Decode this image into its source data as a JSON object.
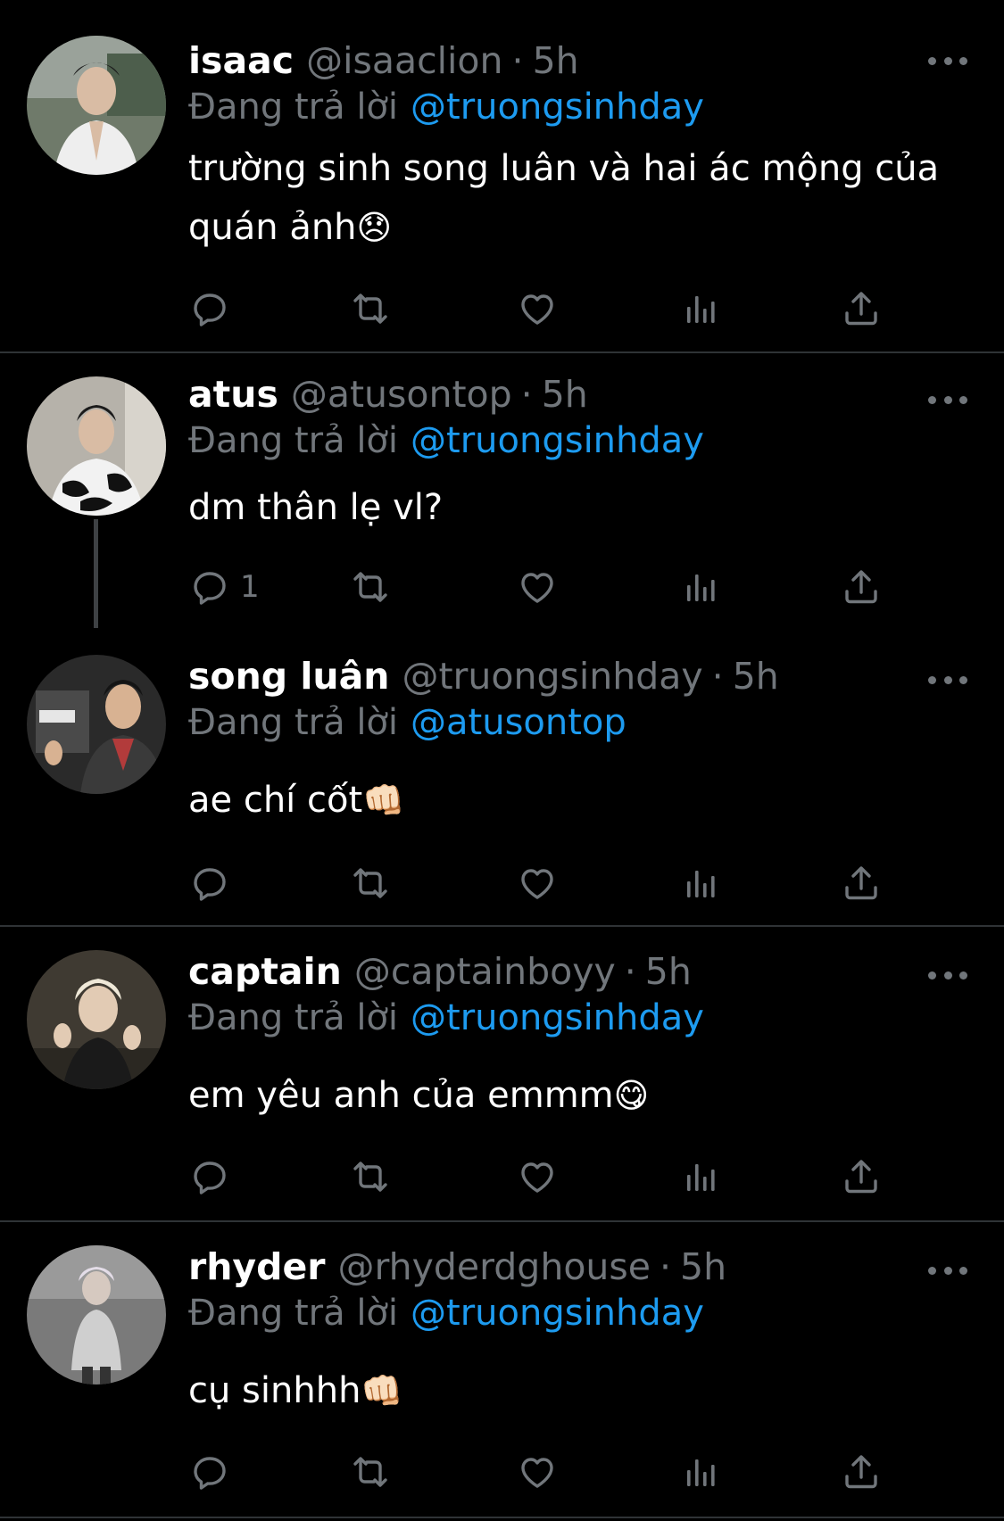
{
  "reply_prefix": "Đang trả lời",
  "tweets": [
    {
      "name": "isaac",
      "handle": "@isaaclion",
      "time": "5h",
      "reply_to": "@truongsinhday",
      "text": "trường sinh song luân và hai ác mộng của quán ảnh",
      "emoji": "😞",
      "reply_count": ""
    },
    {
      "name": "atus",
      "handle": "@atusontop",
      "time": "5h",
      "reply_to": "@truongsinhday",
      "text": "dm thân lẹ vl?",
      "emoji": "",
      "reply_count": "1"
    },
    {
      "name": "song luân",
      "handle": "@truongsinhday",
      "time": "5h",
      "reply_to": "@atusontop",
      "text": "ae chí cốt",
      "emoji": "👊🏻",
      "reply_count": ""
    },
    {
      "name": "captain",
      "handle": "@captainboyy",
      "time": "5h",
      "reply_to": "@truongsinhday",
      "text": "em yêu anh của emmm",
      "emoji": "😋",
      "reply_count": ""
    },
    {
      "name": "rhyder",
      "handle": "@rhyderdghouse",
      "time": "5h",
      "reply_to": "@truongsinhday",
      "text": "cụ sinhhh",
      "emoji": "👊🏻",
      "reply_count": ""
    }
  ],
  "icons": {
    "reply": "reply-icon",
    "retweet": "retweet-icon",
    "like": "like-icon",
    "views": "views-icon",
    "share": "share-icon",
    "more": "more-icon"
  },
  "colors": {
    "background": "#000000",
    "muted": "#71767b",
    "link": "#1d9bf0",
    "divider": "#2f3336"
  }
}
